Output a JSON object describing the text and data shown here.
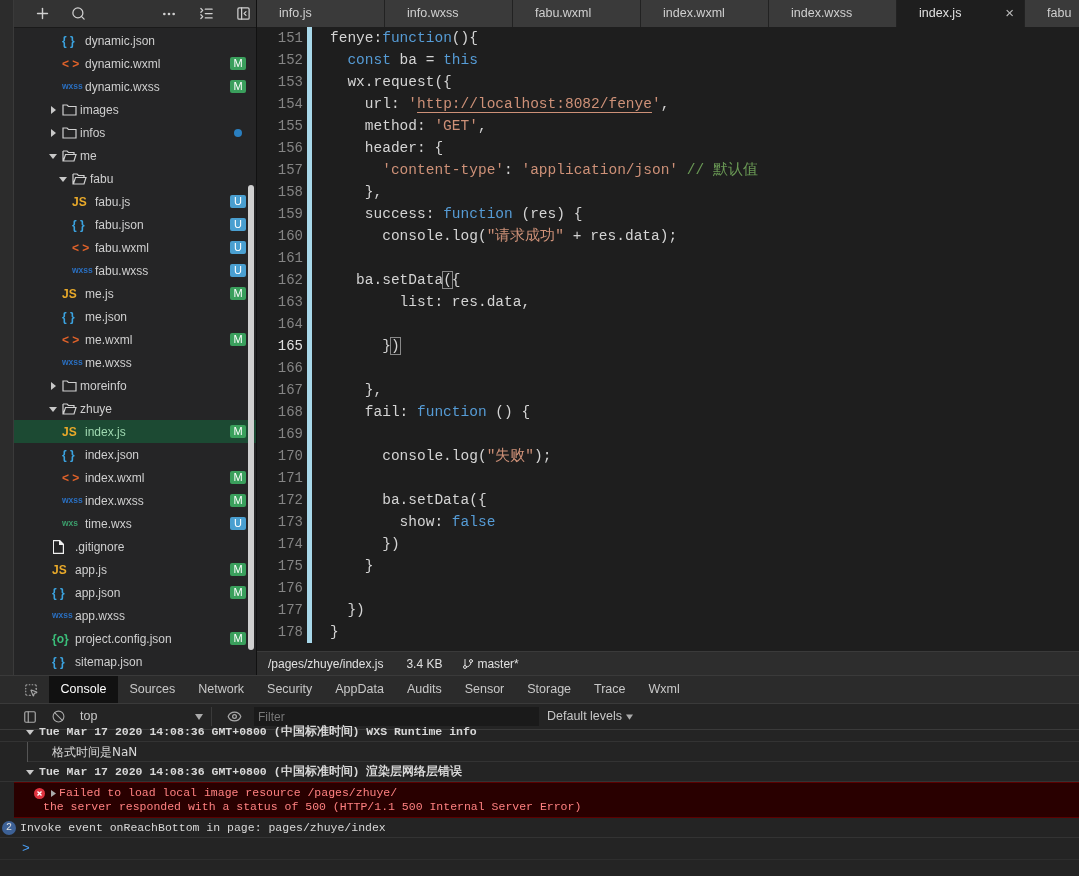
{
  "sidebar": {
    "tree": [
      {
        "children": [
          {
            "name": "dynamic.json",
            "kind": "json",
            "icon": "{ }",
            "selected": false
          },
          {
            "name": "dynamic.wxml",
            "kind": "wxml",
            "icon": "< >",
            "badge": "M",
            "selected": false
          },
          {
            "name": "dynamic.wxss",
            "kind": "wxss",
            "icon": "wxss",
            "badge": "M",
            "selected": false
          }
        ]
      },
      {
        "name": "images",
        "kind": "folder",
        "expanded": false,
        "selected": false
      },
      {
        "name": "infos",
        "kind": "folder",
        "expanded": false,
        "dot": true,
        "selected": false
      },
      {
        "name": "me",
        "kind": "folder",
        "expanded": true,
        "selected": false,
        "children": [
          {
            "name": "fabu",
            "kind": "folder",
            "expanded": true,
            "selected": false,
            "children": [
              {
                "name": "fabu.js",
                "kind": "js",
                "icon": "JS",
                "badge": "U",
                "selected": false
              },
              {
                "name": "fabu.json",
                "kind": "json",
                "icon": "{ }",
                "badge": "U",
                "selected": false
              },
              {
                "name": "fabu.wxml",
                "kind": "wxml",
                "icon": "< >",
                "badge": "U",
                "selected": false
              },
              {
                "name": "fabu.wxss",
                "kind": "wxss",
                "icon": "wxss",
                "badge": "U",
                "selected": false
              }
            ]
          },
          {
            "name": "me.js",
            "kind": "js",
            "icon": "JS",
            "badge": "M",
            "selected": false
          },
          {
            "name": "me.json",
            "kind": "json",
            "icon": "{ }",
            "selected": false
          },
          {
            "name": "me.wxml",
            "kind": "wxml",
            "icon": "< >",
            "badge": "M",
            "selected": false
          },
          {
            "name": "me.wxss",
            "kind": "wxss",
            "icon": "wxss",
            "selected": false
          }
        ]
      },
      {
        "name": "moreinfo",
        "kind": "folder",
        "expanded": false,
        "selected": false
      },
      {
        "name": "zhuye",
        "kind": "folder",
        "expanded": true,
        "selected": false,
        "children": [
          {
            "name": "index.js",
            "kind": "js",
            "icon": "JS",
            "badge": "M",
            "selected": true
          },
          {
            "name": "index.json",
            "kind": "json",
            "icon": "{ }",
            "selected": false
          },
          {
            "name": "index.wxml",
            "kind": "wxml",
            "icon": "< >",
            "badge": "M",
            "selected": false
          },
          {
            "name": "index.wxss",
            "kind": "wxss",
            "icon": "wxss",
            "badge": "M",
            "selected": false
          },
          {
            "name": "time.wxs",
            "kind": "wxs",
            "icon": "wxs",
            "badge": "U",
            "selected": false
          }
        ]
      },
      {
        "name": ".gitignore",
        "kind": "file",
        "selected": false
      },
      {
        "name": "app.js",
        "kind": "js",
        "icon": "JS",
        "badge": "M",
        "selected": false
      },
      {
        "name": "app.json",
        "kind": "json",
        "icon": "{ }",
        "badge": "M",
        "selected": false
      },
      {
        "name": "app.wxss",
        "kind": "wxss",
        "icon": "wxss",
        "selected": false
      },
      {
        "name": "project.config.json",
        "kind": "config",
        "icon": "{o}",
        "badge": "M",
        "selected": false
      },
      {
        "name": "sitemap.json",
        "kind": "json",
        "icon": "{ }",
        "selected": false
      }
    ]
  },
  "tabs": [
    {
      "label": "info.js",
      "selected": false
    },
    {
      "label": "info.wxss",
      "selected": false
    },
    {
      "label": "fabu.wxml",
      "selected": false
    },
    {
      "label": "index.wxml",
      "selected": false
    },
    {
      "label": "index.wxss",
      "selected": false
    },
    {
      "label": "index.js",
      "selected": true,
      "close": "×"
    },
    {
      "label": "fabu",
      "selected": false
    }
  ],
  "code": [
    {
      "n": "151",
      "current": false,
      "tokens": [
        {
          "kind": "plain",
          "t": "fenye:"
        },
        {
          "kind": "keyword",
          "t": "function"
        },
        {
          "kind": "plain",
          "t": "(){"
        }
      ]
    },
    {
      "n": "152",
      "current": false,
      "tokens": [
        {
          "kind": "keyword",
          "t": "  const"
        },
        {
          "kind": "plain",
          "t": " ba = "
        },
        {
          "kind": "keyword",
          "t": "this"
        }
      ]
    },
    {
      "n": "153",
      "current": false,
      "tokens": [
        {
          "kind": "plain",
          "t": "  wx.request({"
        }
      ]
    },
    {
      "n": "154",
      "current": false,
      "tokens": [
        {
          "kind": "plain",
          "t": "    url: "
        },
        {
          "kind": "string",
          "t": "'"
        },
        {
          "kind": "link",
          "t": "http://localhost:8082/fenye"
        },
        {
          "kind": "string",
          "t": "'"
        },
        {
          "kind": "plain",
          "t": ","
        }
      ]
    },
    {
      "n": "155",
      "current": false,
      "tokens": [
        {
          "kind": "plain",
          "t": "    method: "
        },
        {
          "kind": "string",
          "t": "'GET'"
        },
        {
          "kind": "plain",
          "t": ","
        }
      ]
    },
    {
      "n": "156",
      "current": false,
      "tokens": [
        {
          "kind": "plain",
          "t": "    header: {"
        }
      ]
    },
    {
      "n": "157",
      "current": false,
      "tokens": [
        {
          "kind": "string",
          "t": "      'content-type'"
        },
        {
          "kind": "plain",
          "t": ": "
        },
        {
          "kind": "string",
          "t": "'application/json'"
        },
        {
          "kind": "comment",
          "t": " // 默认值"
        }
      ]
    },
    {
      "n": "158",
      "current": false,
      "tokens": [
        {
          "kind": "plain",
          "t": "    },"
        }
      ]
    },
    {
      "n": "159",
      "current": false,
      "tokens": [
        {
          "kind": "plain",
          "t": "    success: "
        },
        {
          "kind": "keyword",
          "t": "function"
        },
        {
          "kind": "plain",
          "t": " (res) {"
        }
      ]
    },
    {
      "n": "160",
      "current": false,
      "tokens": [
        {
          "kind": "plain",
          "t": "      console.log("
        },
        {
          "kind": "string",
          "t": "\"请求成功\""
        },
        {
          "kind": "plain",
          "t": " + res.data);"
        }
      ]
    },
    {
      "n": "161",
      "current": false
    },
    {
      "n": "162",
      "current": false,
      "tokens": [
        {
          "kind": "plain",
          "t": "   ba.setData"
        },
        {
          "kind": "bracket",
          "t": "("
        },
        {
          "kind": "plain",
          "t": "{"
        }
      ]
    },
    {
      "n": "163",
      "current": false,
      "tokens": [
        {
          "kind": "plain",
          "t": "        list: res.data,"
        }
      ]
    },
    {
      "n": "164",
      "current": false
    },
    {
      "n": "165",
      "current": true,
      "tokens": [
        {
          "kind": "plain",
          "t": "      }"
        },
        {
          "kind": "bracket",
          "t": ")"
        }
      ]
    },
    {
      "n": "166",
      "current": false
    },
    {
      "n": "167",
      "current": false,
      "tokens": [
        {
          "kind": "plain",
          "t": "    },"
        }
      ]
    },
    {
      "n": "168",
      "current": false,
      "tokens": [
        {
          "kind": "plain",
          "t": "    fail: "
        },
        {
          "kind": "keyword",
          "t": "function"
        },
        {
          "kind": "plain",
          "t": " () {"
        }
      ]
    },
    {
      "n": "169",
      "current": false
    },
    {
      "n": "170",
      "current": false,
      "tokens": [
        {
          "kind": "plain",
          "t": "      console.log("
        },
        {
          "kind": "string",
          "t": "\"失败\""
        },
        {
          "kind": "plain",
          "t": ");"
        }
      ]
    },
    {
      "n": "171",
      "current": false
    },
    {
      "n": "172",
      "current": false,
      "tokens": [
        {
          "kind": "plain",
          "t": "      ba.setData({"
        }
      ]
    },
    {
      "n": "173",
      "current": false,
      "tokens": [
        {
          "kind": "plain",
          "t": "        show: "
        },
        {
          "kind": "keyword",
          "t": "false"
        }
      ]
    },
    {
      "n": "174",
      "current": false,
      "tokens": [
        {
          "kind": "plain",
          "t": "      })"
        }
      ]
    },
    {
      "n": "175",
      "current": false,
      "tokens": [
        {
          "kind": "plain",
          "t": "    }"
        }
      ]
    },
    {
      "n": "176",
      "current": false
    },
    {
      "n": "177",
      "current": false,
      "tokens": [
        {
          "kind": "plain",
          "t": "  })"
        }
      ]
    },
    {
      "n": "178",
      "current": false,
      "tokens": [
        {
          "kind": "plain",
          "t": "}"
        }
      ]
    }
  ],
  "status_bar": {
    "path": "/pages/zhuye/index.js",
    "size": "3.4 KB",
    "branch": "master*"
  },
  "devtools": {
    "tabs": [
      {
        "label": "Console",
        "selected": true
      },
      {
        "label": "Sources",
        "selected": false
      },
      {
        "label": "Network",
        "selected": false
      },
      {
        "label": "Security",
        "selected": false
      },
      {
        "label": "AppData",
        "selected": false
      },
      {
        "label": "Audits",
        "selected": false
      },
      {
        "label": "Sensor",
        "selected": false
      },
      {
        "label": "Storage",
        "selected": false
      },
      {
        "label": "Trace",
        "selected": false
      },
      {
        "label": "Wxml",
        "selected": false
      }
    ],
    "context": "top",
    "filter": {
      "placeholder": "Filter"
    },
    "levels": "Default levels",
    "messages": [
      {
        "kind": "group",
        "title": "Tue Mar 17 2020 14:08:36 GMT+0800 (中国标准时间) WXS Runtime info",
        "expanded": true,
        "children": [
          {
            "kind": "log",
            "lines": [
              "格式时间是NaN"
            ]
          }
        ]
      },
      {
        "kind": "group",
        "title": "Tue Mar 17 2020 14:08:36 GMT+0800 (中国标准时间) 渲染层网络层错误",
        "expanded": true,
        "children": [
          {
            "kind": "error",
            "lines": [
              "Failed to load local image resource /pages/zhuye/",
              "the server responded with a status of 500 (HTTP/1.1 500 Internal Server Error)"
            ]
          }
        ]
      },
      {
        "kind": "log",
        "count": "2",
        "lines": [
          "Invoke event onReachBottom in page: pages/zhuye/index"
        ]
      }
    ],
    "prompt": ">"
  }
}
